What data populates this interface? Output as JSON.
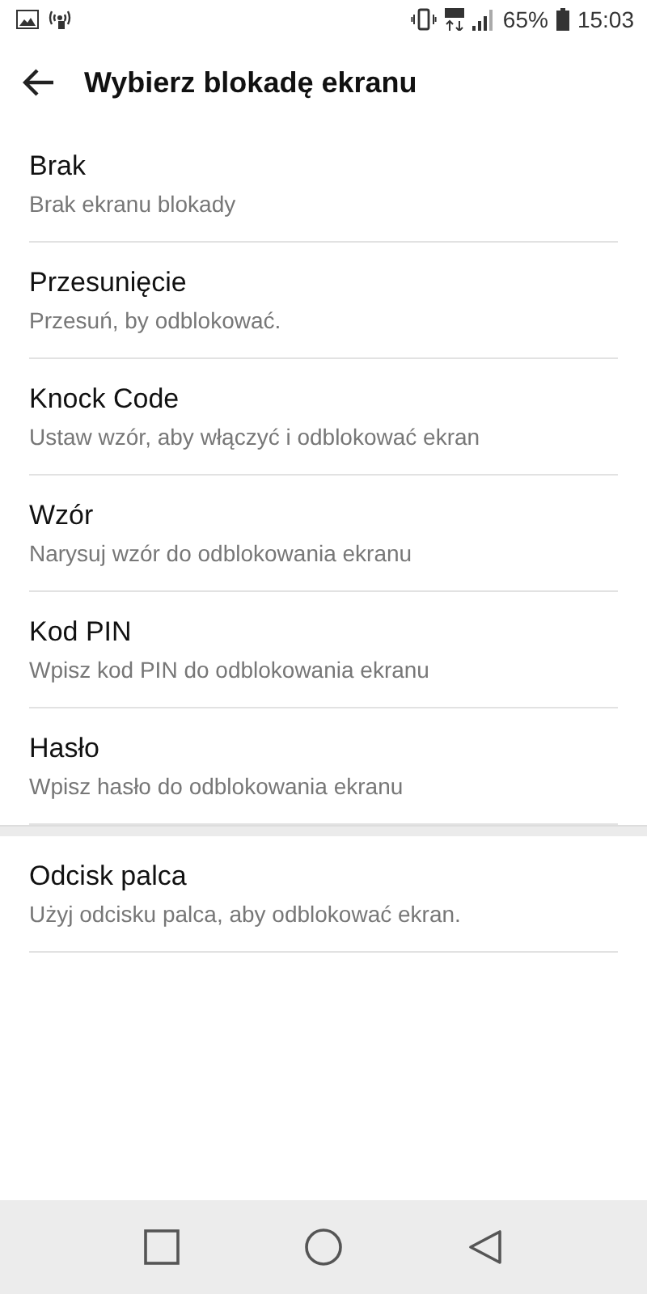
{
  "status_bar": {
    "battery": "65%",
    "time": "15:03"
  },
  "app_bar": {
    "title": "Wybierz blokadę ekranu"
  },
  "groups": [
    {
      "items": [
        {
          "title": "Brak",
          "subtitle": "Brak ekranu blokady"
        },
        {
          "title": "Przesunięcie",
          "subtitle": "Przesuń, by odblokować."
        },
        {
          "title": "Knock Code",
          "subtitle": "Ustaw wzór, aby włączyć i odblokować ekran"
        },
        {
          "title": "Wzór",
          "subtitle": "Narysuj wzór do odblokowania ekranu"
        },
        {
          "title": "Kod PIN",
          "subtitle": "Wpisz kod PIN do odblokowania ekranu"
        },
        {
          "title": "Hasło",
          "subtitle": "Wpisz hasło do odblokowania ekranu"
        }
      ]
    },
    {
      "items": [
        {
          "title": "Odcisk palca",
          "subtitle": "Użyj odcisku palca, aby odblokować ekran."
        }
      ]
    }
  ]
}
